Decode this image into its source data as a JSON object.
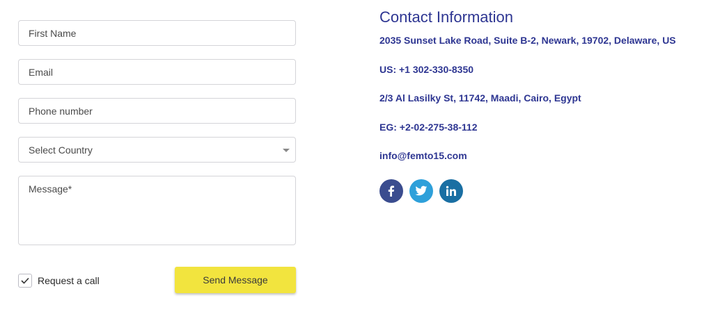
{
  "form": {
    "first_name_placeholder": "First Name",
    "email_placeholder": "Email",
    "phone_placeholder": "Phone number",
    "country_value": "Select Country",
    "message_placeholder": "Message*",
    "request_call_label": "Request a call",
    "request_call_checked": true,
    "send_label": "Send Message"
  },
  "contact": {
    "title": "Contact Information",
    "address_us": "2035 Sunset Lake Road, Suite B-2, Newark, 19702, Delaware, US",
    "phone_us": "US: +1 302-330-8350",
    "address_eg": "2/3 Al Lasilky St, 11742, Maadi, Cairo, Egypt",
    "phone_eg": "EG: +2-02-275-38-112",
    "email": "info@femto15.com"
  },
  "social": [
    {
      "icon": "facebook-icon",
      "color": "#3b4d8f"
    },
    {
      "icon": "twitter-icon",
      "color": "#2ea0da"
    },
    {
      "icon": "linkedin-icon",
      "color": "#1a6fa3"
    }
  ],
  "colors": {
    "accent_text": "#2e3692",
    "button_bg": "#f2e43e",
    "border": "#d4d4d8"
  }
}
